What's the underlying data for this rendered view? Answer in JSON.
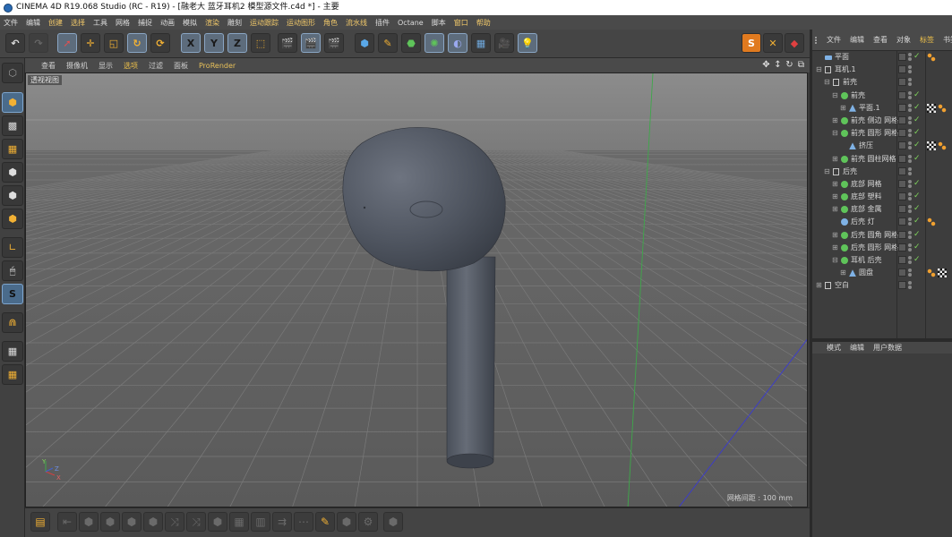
{
  "window": {
    "title": "CINEMA 4D R19.068 Studio (RC - R19) - [融老大 蓝牙耳机2 模型源文件.c4d *] - 主要"
  },
  "menubar": {
    "items": [
      {
        "label": "文件",
        "highlight": false
      },
      {
        "label": "编辑",
        "highlight": false
      },
      {
        "label": "创建",
        "highlight": true
      },
      {
        "label": "选择",
        "highlight": true
      },
      {
        "label": "工具",
        "highlight": false
      },
      {
        "label": "网格",
        "highlight": false
      },
      {
        "label": "捕捉",
        "highlight": false
      },
      {
        "label": "动画",
        "highlight": false
      },
      {
        "label": "模拟",
        "highlight": false
      },
      {
        "label": "渲染",
        "highlight": true
      },
      {
        "label": "雕刻",
        "highlight": false
      },
      {
        "label": "运动跟踪",
        "highlight": true
      },
      {
        "label": "运动图形",
        "highlight": true
      },
      {
        "label": "角色",
        "highlight": true
      },
      {
        "label": "流水线",
        "highlight": true
      },
      {
        "label": "插件",
        "highlight": false
      },
      {
        "label": "Octane",
        "highlight": false
      },
      {
        "label": "脚本",
        "highlight": false
      },
      {
        "label": "窗口",
        "highlight": true
      },
      {
        "label": "帮助",
        "highlight": true
      }
    ]
  },
  "toolbar": {
    "axis_x": "X",
    "axis_y": "Y",
    "axis_z": "Z"
  },
  "viewport_menu": {
    "items": [
      {
        "label": "查看",
        "type": "normal"
      },
      {
        "label": "摄像机",
        "type": "normal"
      },
      {
        "label": "显示",
        "type": "normal"
      },
      {
        "label": "选项",
        "type": "sel"
      },
      {
        "label": "过滤",
        "type": "normal"
      },
      {
        "label": "面板",
        "type": "normal"
      },
      {
        "label": "ProRender",
        "type": "pr"
      }
    ]
  },
  "viewport": {
    "label": "透视视图",
    "grid_spacing": "网格间距 : 100 mm",
    "axis_y": "Y",
    "axis_x": "X",
    "axis_z": "Z"
  },
  "object_manager": {
    "menu": [
      {
        "label": "文件",
        "sel": false
      },
      {
        "label": "编辑",
        "sel": false
      },
      {
        "label": "查看",
        "sel": false
      },
      {
        "label": "对象",
        "sel": false
      },
      {
        "label": "标签",
        "sel": true
      },
      {
        "label": "书签",
        "sel": false
      }
    ],
    "rows": [
      {
        "name": "平面",
        "depth": 0,
        "icon": "plane-icon",
        "color": "#7fb2e5",
        "check": true,
        "tags": [
          "orange-dots"
        ],
        "exp": ""
      },
      {
        "name": "耳机.1",
        "depth": 0,
        "icon": "null-icon",
        "color": "#c8c8c8",
        "check": false,
        "tags": [],
        "exp": "-"
      },
      {
        "name": "前壳",
        "depth": 1,
        "icon": "null-icon",
        "color": "#c8c8c8",
        "check": false,
        "tags": [],
        "exp": "-"
      },
      {
        "name": "前壳",
        "depth": 2,
        "icon": "subdivision-icon",
        "color": "#5fc45a",
        "check": true,
        "tags": [],
        "exp": "-"
      },
      {
        "name": "平面.1",
        "depth": 3,
        "icon": "polygon-icon",
        "color": "#7fb2e5",
        "check": true,
        "tags": [
          "checker",
          "orange-dots"
        ],
        "exp": "+"
      },
      {
        "name": "前壳 侧边 网格",
        "depth": 2,
        "icon": "subdivision-icon",
        "color": "#5fc45a",
        "check": true,
        "tags": [],
        "exp": "+"
      },
      {
        "name": "前壳 圆形 网格",
        "depth": 2,
        "icon": "subdivision-icon",
        "color": "#5fc45a",
        "check": true,
        "tags": [],
        "exp": "-"
      },
      {
        "name": "挤压",
        "depth": 3,
        "icon": "polygon-icon",
        "color": "#7fb2e5",
        "check": true,
        "tags": [
          "checker",
          "orange-dots"
        ],
        "exp": ""
      },
      {
        "name": "前壳 圆柱网格",
        "depth": 2,
        "icon": "subdivision-icon",
        "color": "#5fc45a",
        "check": true,
        "tags": [],
        "exp": "+"
      },
      {
        "name": "后壳",
        "depth": 1,
        "icon": "null-icon",
        "color": "#c8c8c8",
        "check": false,
        "tags": [],
        "exp": "-"
      },
      {
        "name": "底部 网格",
        "depth": 2,
        "icon": "subdivision-icon",
        "color": "#5fc45a",
        "check": true,
        "tags": [],
        "exp": "+"
      },
      {
        "name": "底部 塑料",
        "depth": 2,
        "icon": "subdivision-icon",
        "color": "#5fc45a",
        "check": true,
        "tags": [],
        "exp": "+"
      },
      {
        "name": "底部 金属",
        "depth": 2,
        "icon": "subdivision-icon",
        "color": "#5fc45a",
        "check": true,
        "tags": [],
        "exp": "+"
      },
      {
        "name": "后壳 灯",
        "depth": 2,
        "icon": "light-icon",
        "color": "#7fb2e5",
        "check": true,
        "tags": [
          "orange-dots"
        ],
        "exp": ""
      },
      {
        "name": "后壳 圆角 网格",
        "depth": 2,
        "icon": "subdivision-icon",
        "color": "#5fc45a",
        "check": true,
        "tags": [],
        "exp": "+"
      },
      {
        "name": "后壳 圆形 网格",
        "depth": 2,
        "icon": "subdivision-icon",
        "color": "#5fc45a",
        "check": true,
        "tags": [],
        "exp": "+"
      },
      {
        "name": "耳机 后壳",
        "depth": 2,
        "icon": "subdivision-icon",
        "color": "#5fc45a",
        "check": true,
        "tags": [],
        "exp": "-"
      },
      {
        "name": "圆盘",
        "depth": 3,
        "icon": "polygon-icon",
        "color": "#7fb2e5",
        "check": false,
        "tags": [
          "orange-dots",
          "checker"
        ],
        "exp": "+"
      },
      {
        "name": "空白",
        "depth": 0,
        "icon": "null-icon",
        "color": "#c8c8c8",
        "check": false,
        "tags": [],
        "exp": "+"
      }
    ]
  },
  "attribute_manager": {
    "menu": [
      "模式",
      "编辑",
      "用户数据"
    ]
  }
}
